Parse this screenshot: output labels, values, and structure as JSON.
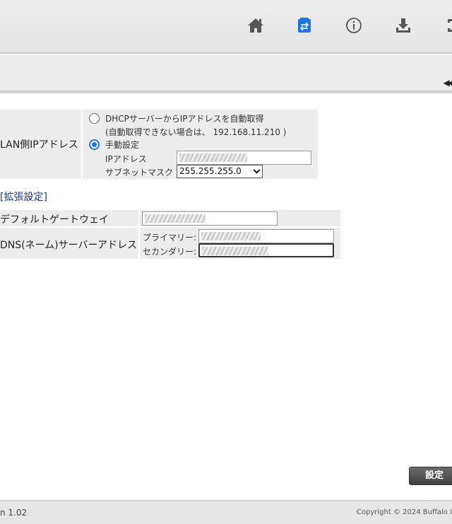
{
  "nav": {
    "icons": [
      "home-icon",
      "settings-transfer-icon",
      "info-icon",
      "download-icon",
      "logout-icon"
    ],
    "active": "settings-transfer-icon",
    "active_color": "#1a73e8"
  },
  "lan": {
    "label": "LAN側IPアドレス",
    "dhcp_option": "DHCPサーバーからIPアドレスを自動取得",
    "dhcp_note": "(自動取得できない場合は、 192.168.11.210 )",
    "manual_option": "手動設定",
    "ip_label": "IPアドレス",
    "subnet_label": "サブネットマスク",
    "subnet_value": "255.255.255.0"
  },
  "extended_link": "[拡張設定]",
  "gateway": {
    "label": "デフォルトゲートウェイ"
  },
  "dns": {
    "label": "DNS(ネーム)サーバーアドレス",
    "primary_label": "プライマリー:",
    "secondary_label": "セカンダリー:"
  },
  "submit_label": "設定",
  "footer": {
    "version": "n 1.02",
    "copyright": "Copyright © 2024 Buffalo I"
  }
}
